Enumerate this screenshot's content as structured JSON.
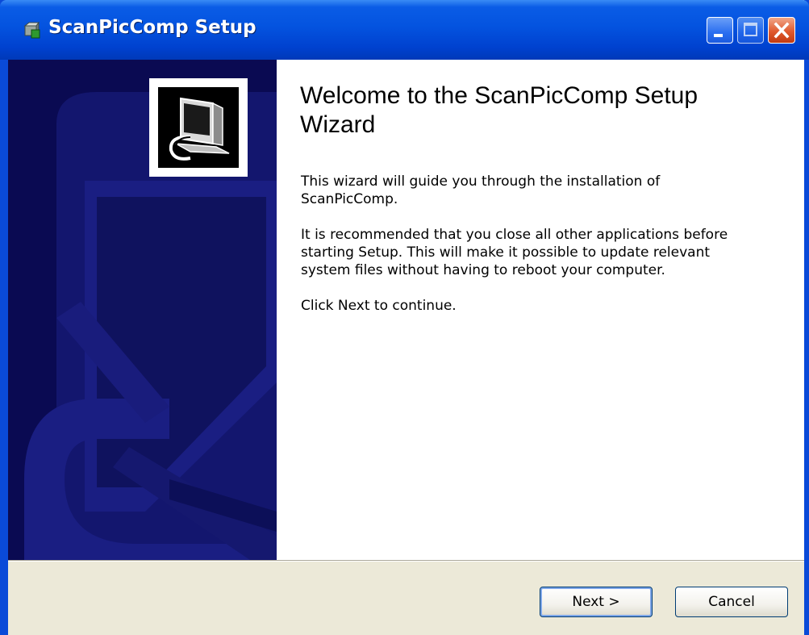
{
  "window": {
    "title": "ScanPicComp Setup",
    "controls": {
      "minimize": "minimize",
      "maximize": "maximize",
      "close": "close"
    }
  },
  "wizard": {
    "heading": "Welcome to the ScanPicComp Setup Wizard",
    "paragraphs": [
      "This wizard will guide you through the installation of ScanPicComp.",
      "It is recommended that you close all other applications before starting Setup. This will make it possible to update relevant system files without having to reboot your computer.",
      "Click Next to continue."
    ]
  },
  "buttons": {
    "next": "Next >",
    "cancel": "Cancel"
  },
  "icons": {
    "app": "installer-icon",
    "logo": "computer-install-icon"
  },
  "colors": {
    "titlebar": "#0453df",
    "side_panel": "#0a0a52",
    "dialog_bg": "#ece9d8",
    "close_button": "#e05a2e"
  }
}
